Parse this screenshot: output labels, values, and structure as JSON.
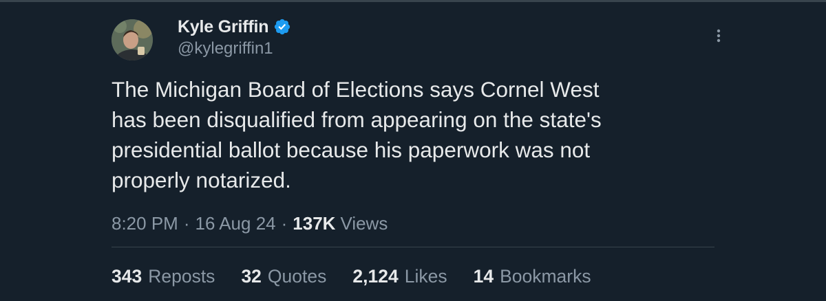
{
  "author": {
    "display_name": "Kyle Griffin",
    "handle": "@kylegriffin1",
    "verified": true
  },
  "tweet": {
    "text": "The Michigan Board of Elections says Cornel West\nhas been disqualified from appearing on the state's\npresidential ballot because his paperwork was not\nproperly notarized."
  },
  "meta": {
    "time": "8:20 PM",
    "separator": "·",
    "date": "16 Aug 24",
    "views_count": "137K",
    "views_label": "Views"
  },
  "stats": {
    "reposts": {
      "count": "343",
      "label": "Reposts"
    },
    "quotes": {
      "count": "32",
      "label": "Quotes"
    },
    "likes": {
      "count": "2,124",
      "label": "Likes"
    },
    "bookmarks": {
      "count": "14",
      "label": "Bookmarks"
    }
  },
  "icons": {
    "verified": "verified-badge-icon",
    "more": "more-options-icon"
  },
  "colors": {
    "background": "#15202b",
    "primary_text": "#e7e9ea",
    "secondary_text": "#8b98a5",
    "verified_blue": "#1d9bf0",
    "divider": "#38444d"
  }
}
